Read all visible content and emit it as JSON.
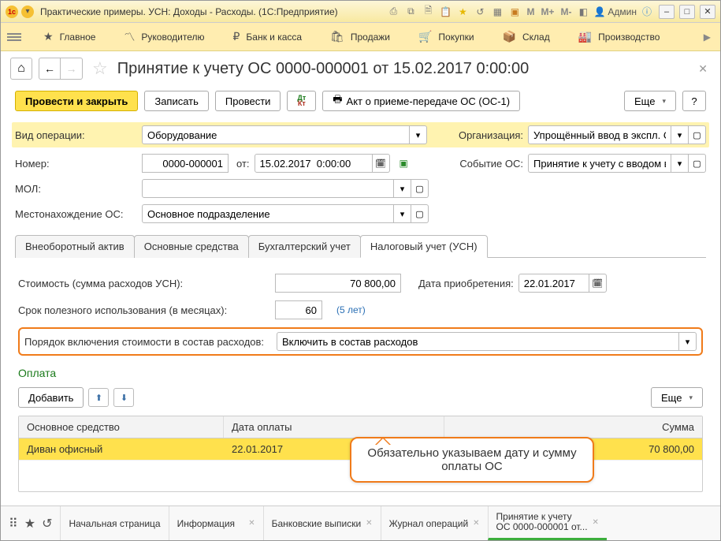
{
  "window_title": "Практические примеры. УСН: Доходы - Расходы.  (1С:Предприятие)",
  "sys_menu_memory": [
    "M",
    "M+",
    "M-"
  ],
  "admin_label": "Админ",
  "menubar": [
    "Главное",
    "Руководителю",
    "Банк и касса",
    "Продажи",
    "Покупки",
    "Склад",
    "Производство"
  ],
  "page_title": "Принятие к учету ОС 0000-000001 от 15.02.2017 0:00:00",
  "action_buttons": {
    "commit_close": "Провести и закрыть",
    "save": "Записать",
    "commit": "Провести",
    "act": "Акт о приеме-передаче ОС (ОС-1)",
    "more": "Еще",
    "help": "?"
  },
  "fields": {
    "operation_type_label": "Вид операции:",
    "operation_type_value": "Оборудование",
    "org_label": "Организация:",
    "org_value": "Упрощённый ввод в экспл. ОС (",
    "number_label": "Номер:",
    "number_value": "0000-000001",
    "from_label": "от:",
    "date_value": "15.02.2017  0:00:00",
    "event_label": "Событие ОС:",
    "event_value": "Принятие к учету с вводом в эк",
    "mol_label": "МОЛ:",
    "mol_value": "",
    "location_label": "Местонахождение ОС:",
    "location_value": "Основное подразделение"
  },
  "tabs": [
    "Внеоборотный актив",
    "Основные средства",
    "Бухгалтерский учет",
    "Налоговый учет (УСН)"
  ],
  "active_tab_index": 3,
  "usn": {
    "cost_label": "Стоимость (сумма расходов УСН):",
    "cost_value": "70 800,00",
    "acq_date_label": "Дата приобретения:",
    "acq_date_value": "22.01.2017",
    "useful_life_label": "Срок полезного использования (в месяцах):",
    "useful_life_value": "60",
    "useful_life_hint": "(5 лет)",
    "include_label": "Порядок включения стоимости в состав расходов:",
    "include_value": "Включить в состав расходов"
  },
  "payment": {
    "section": "Оплата",
    "add": "Добавить",
    "more": "Еще",
    "columns": [
      "Основное средство",
      "Дата оплаты",
      "Сумма"
    ],
    "rows": [
      {
        "asset": "Диван офисный",
        "date": "22.01.2017",
        "sum": "70 800,00"
      }
    ]
  },
  "callout_text": "Обязательно указываем дату и сумму оплаты ОС",
  "bottom_tabs": [
    {
      "label": "Начальная страница",
      "closable": false
    },
    {
      "label": "Информация",
      "closable": true
    },
    {
      "label": "Банковские выписки",
      "closable": true
    },
    {
      "label": "Журнал операций",
      "closable": true
    },
    {
      "label_l1": "Принятие к учету",
      "label_l2": "ОС 0000-000001 от...",
      "closable": true,
      "active": true
    }
  ]
}
